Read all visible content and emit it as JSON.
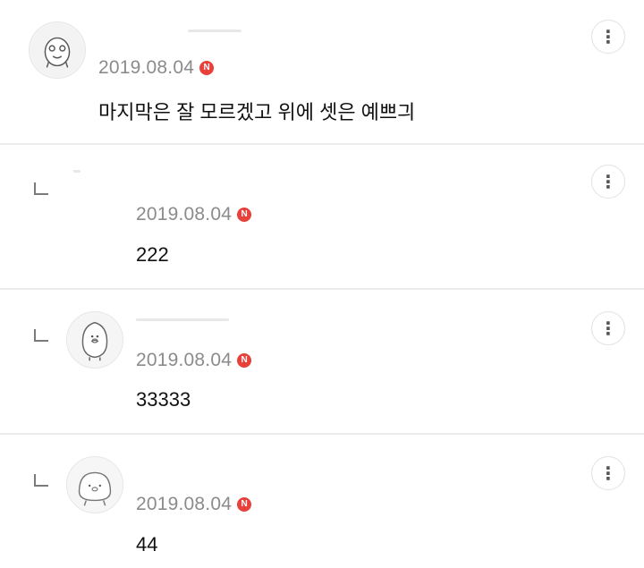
{
  "comments": [
    {
      "date": "2019.08.04",
      "badge": "N",
      "text": "마지막은 잘 모르겠고 위에 셋은 예쁘긔",
      "menu_icon": "⋮",
      "avatar_icon": "character-avatar-icon"
    },
    {
      "date": "2019.08.04",
      "badge": "N",
      "text": "222",
      "menu_icon": "⋮"
    },
    {
      "date": "2019.08.04",
      "badge": "N",
      "text": "33333",
      "menu_icon": "⋮",
      "avatar_icon": "penguin-avatar-icon"
    },
    {
      "date": "2019.08.04",
      "badge": "N",
      "text": "44",
      "menu_icon": "⋮",
      "avatar_icon": "blob-avatar-icon"
    }
  ],
  "colors": {
    "badge": "#e8403a",
    "date": "#8b8b8b",
    "divider": "#ececec"
  }
}
